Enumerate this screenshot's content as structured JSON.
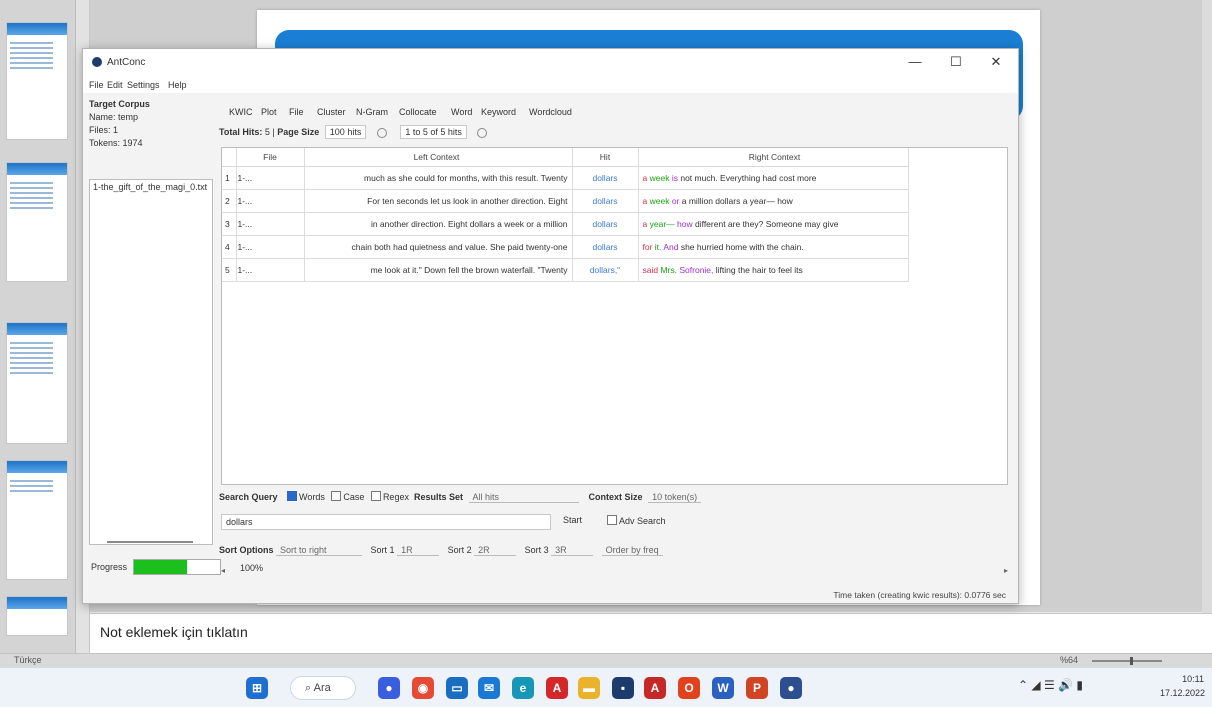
{
  "powerpoint": {
    "notes_placeholder": "Not eklemek için tıklatın",
    "status_left": "Türkçe",
    "status_zoom": "%64"
  },
  "antconc": {
    "title": "AntConc",
    "menu": [
      "File",
      "Edit",
      "Settings",
      "Help"
    ],
    "target_corpus": {
      "heading": "Target Corpus",
      "name": "Name: temp",
      "files": "Files: 1",
      "tokens": "Tokens: 1974",
      "corpus_file": "1-the_gift_of_the_magi_0.txt"
    },
    "progress_label": "Progress",
    "progress_value": 100,
    "progress_text": "100%",
    "tabs": [
      "KWIC",
      "Plot",
      "File",
      "Cluster",
      "N-Gram",
      "Collocate",
      "Word",
      "Keyword",
      "Wordcloud"
    ],
    "hits": {
      "total_hits_label": "Total Hits:",
      "total_hits": "5",
      "page_size_label": "Page Size",
      "page_size": "100 hits",
      "range": "1 to 5 of 5 hits"
    },
    "kwic_headers": [
      "File",
      "Left Context",
      "Hit",
      "Right Context"
    ],
    "kwic_rows": [
      {
        "n": "1",
        "file": "1-...",
        "left": "much as she could for months, with this result. Twenty",
        "hit": "dollars",
        "r1": "a",
        "r2": "week",
        "r3": "is",
        "rest": "not much. Everything had cost more"
      },
      {
        "n": "2",
        "file": "1-...",
        "left": "For ten seconds let us look in another direction. Eight",
        "hit": "dollars",
        "r1": "a",
        "r2": "week",
        "r3": "or",
        "rest": "a million dollars a year— how"
      },
      {
        "n": "3",
        "file": "1-...",
        "left": "in another direction. Eight dollars a week or a million",
        "hit": "dollars",
        "r1": "a",
        "r2": "year—",
        "r3": "how",
        "rest": "different are they? Someone may give"
      },
      {
        "n": "4",
        "file": "1-...",
        "left": "chain both had quietness and value. She paid twenty-one",
        "hit": "dollars",
        "r1": "for",
        "r2": "it.",
        "r3": "And",
        "rest": "she hurried home with the chain."
      },
      {
        "n": "5",
        "file": "1-...",
        "left": "me look at it.\" Down fell the brown waterfall. \"Twenty",
        "hit": "dollars,\"",
        "r1": "said",
        "r2": "Mrs.",
        "r3": "Sofronie,",
        "rest": "lifting the hair to feel its"
      }
    ],
    "search": {
      "query_label": "Search Query",
      "words": "Words",
      "case": "Case",
      "regex": "Regex",
      "results_set_label": "Results Set",
      "results_set": "All hits",
      "context_size_label": "Context Size",
      "context_size": "10 token(s)",
      "query": "dollars",
      "start": "Start",
      "adv_search": "Adv Search"
    },
    "sort": {
      "label": "Sort Options",
      "mode": "Sort to right",
      "sort1_label": "Sort 1",
      "sort1": "1R",
      "sort2_label": "Sort 2",
      "sort2": "2R",
      "sort3_label": "Sort 3",
      "sort3": "3R",
      "order": "Order by freq"
    },
    "timing": "Time taken (creating kwic results): 0.0776 sec"
  },
  "taskbar": {
    "search_label": "Ara",
    "time": "10:11",
    "date": "17.12.2022"
  },
  "colors": {
    "accent": "#1a7fd4",
    "progress": "#1cc01c",
    "hit": "#3a7bd5",
    "r1": "#d9304a",
    "r2": "#18a318",
    "r3": "#a030c8"
  }
}
